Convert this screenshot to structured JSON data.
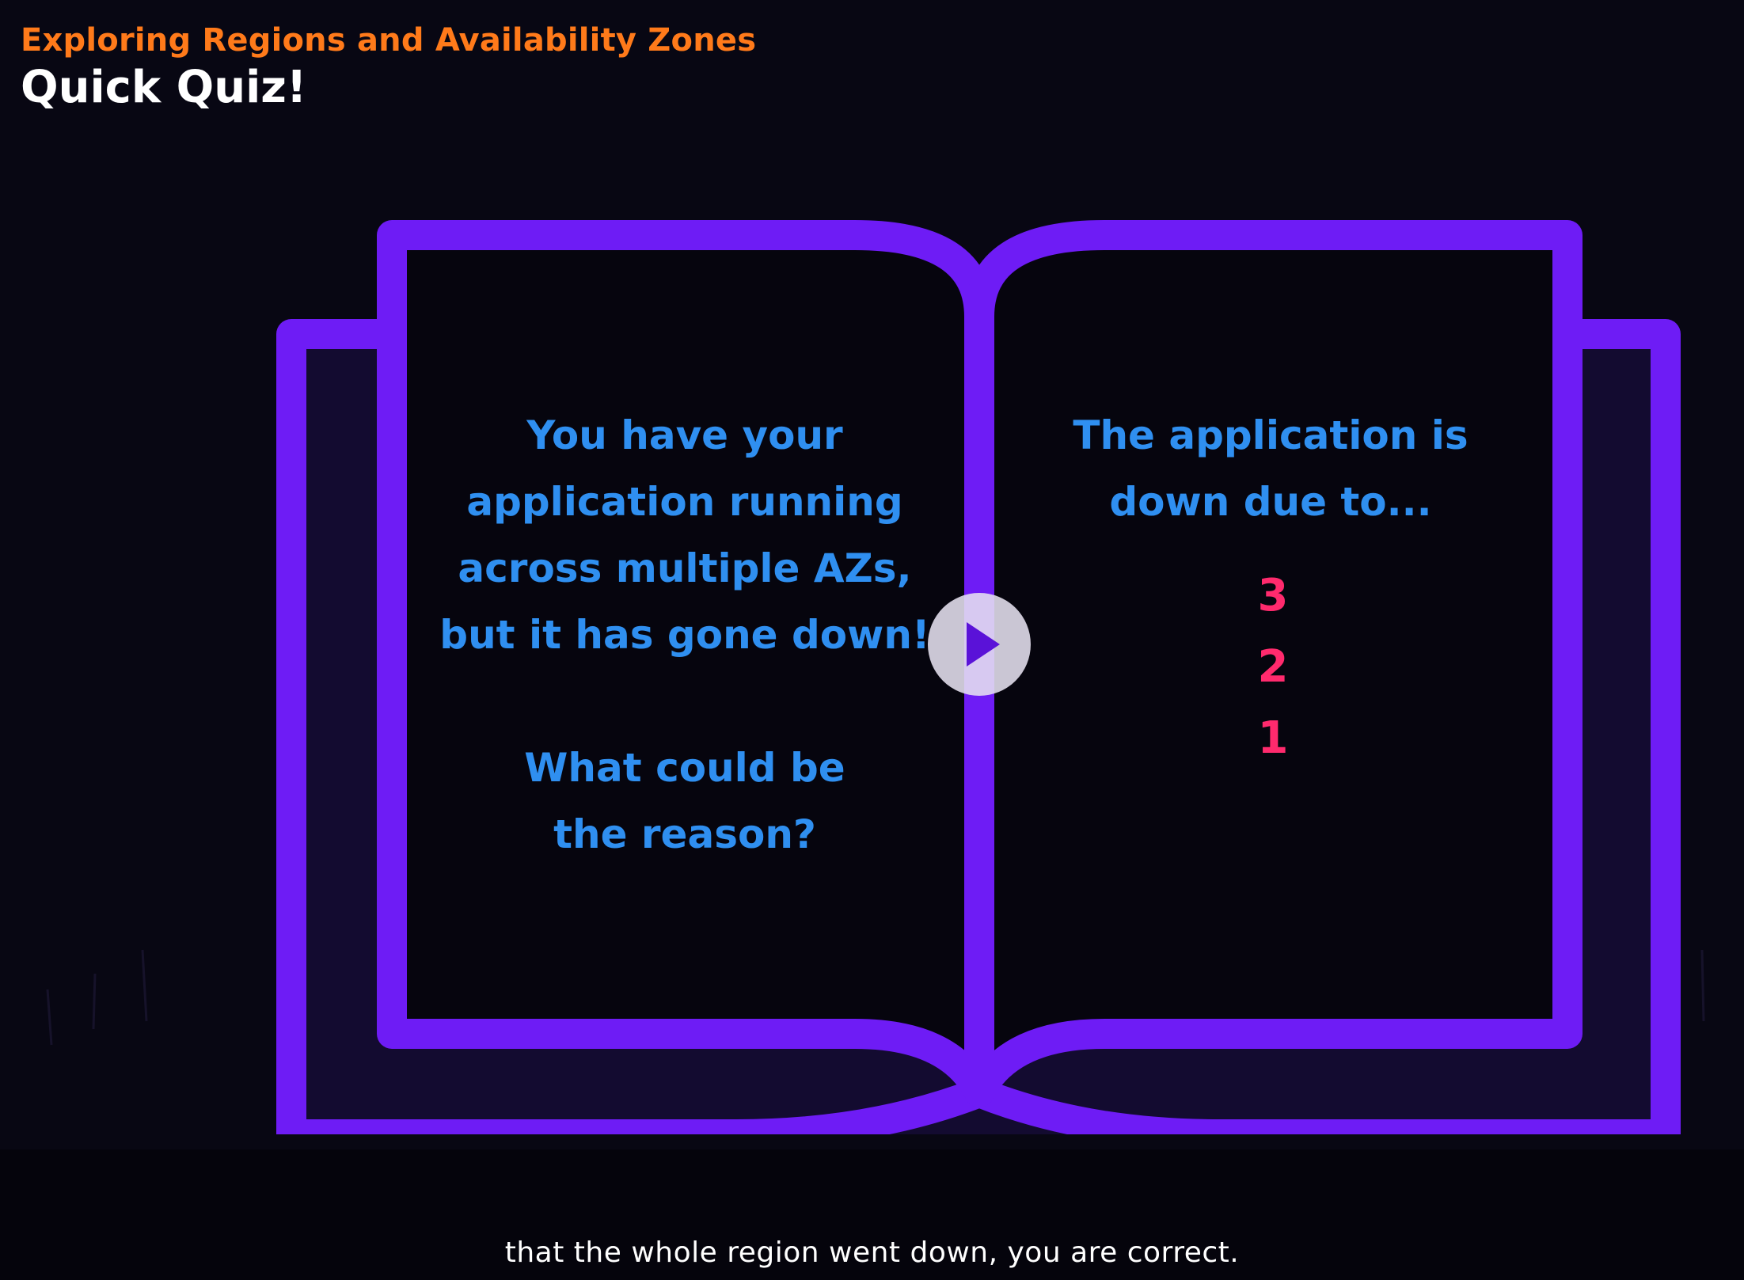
{
  "header": {
    "course_title": "Exploring Regions and Availability Zones",
    "slide_title": "Quick Quiz!"
  },
  "book": {
    "left_page": {
      "lines": [
        "You have your",
        "application running",
        "across multiple AZs,",
        "but it has gone down!"
      ],
      "question_lines": [
        "What could be",
        "the reason?"
      ]
    },
    "right_page": {
      "lines": [
        "The application is",
        "down due to..."
      ],
      "countdown": [
        "3",
        "2",
        "1"
      ]
    }
  },
  "player": {
    "play_icon": "play-icon"
  },
  "caption": "that the whole region went down, you are correct.",
  "colors": {
    "background": "#080713",
    "book_stroke": "#6e1cf5",
    "course_title": "#ff7a1a",
    "page_text": "#2f8ff0",
    "countdown": "#ff2a6d"
  }
}
